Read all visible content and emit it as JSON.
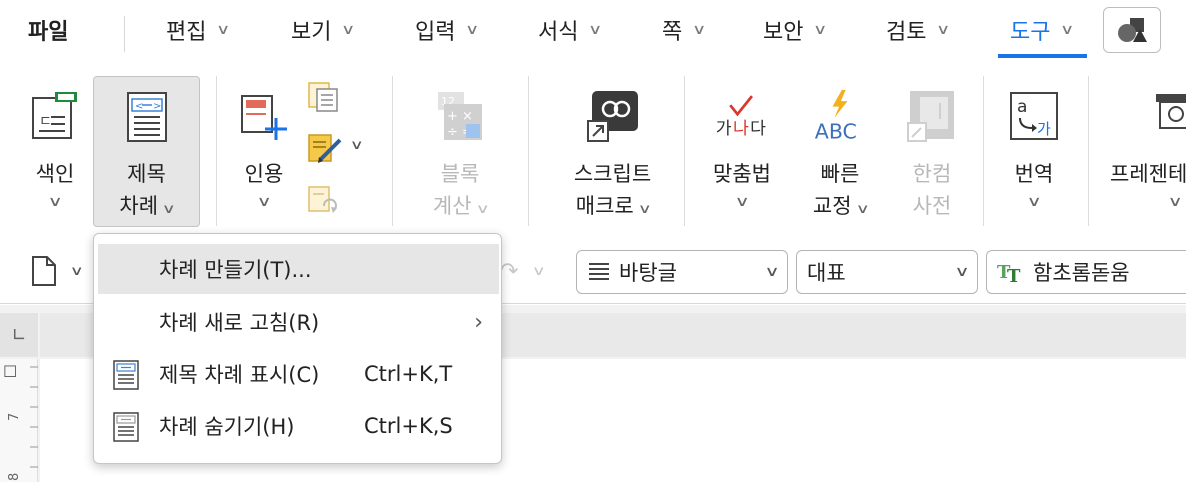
{
  "menubar": {
    "file": "파일",
    "items": [
      "편집",
      "보기",
      "입력",
      "서식",
      "쪽",
      "보안",
      "검토",
      "도구"
    ],
    "active": "도구",
    "accent": "#1a73e8"
  },
  "ribbon": {
    "index": {
      "label": "색인"
    },
    "toc": {
      "line1": "제목",
      "line2": "차례"
    },
    "citation": {
      "label": "인용"
    },
    "block_calc": {
      "line1": "블록",
      "line2": "계산"
    },
    "script": {
      "line1": "스크립트",
      "line2": "매크로"
    },
    "spell": {
      "label": "맞춤법",
      "icon_text_a": "가",
      "icon_text_b": "나",
      "icon_text_c": "다"
    },
    "quick_fix": {
      "line1": "빠른",
      "line2": "교정",
      "icon_text": "ABC"
    },
    "hancom_dict": {
      "line1": "한컴",
      "line2": "사전"
    },
    "translate": {
      "label": "번역",
      "icon_a": "a",
      "icon_b": "가"
    },
    "presentation": {
      "label": "프레젠테"
    }
  },
  "format_bar": {
    "style": "바탕글",
    "font_lang": "대표",
    "font": "함초롬돋움"
  },
  "dropdown": {
    "items": [
      {
        "label": "차례 만들기(T)...",
        "shortcut": "",
        "has_icon": false,
        "submenu": false
      },
      {
        "label": "차례 새로 고침(R)",
        "shortcut": "",
        "has_icon": false,
        "submenu": true
      },
      {
        "label": "제목 차례 표시(C)",
        "shortcut": "Ctrl+K,T",
        "has_icon": true,
        "submenu": false
      },
      {
        "label": "차례 숨기기(H)",
        "shortcut": "Ctrl+K,S",
        "has_icon": true,
        "submenu": false
      }
    ]
  },
  "rulers": {
    "v_marks": [
      "7",
      "8"
    ]
  }
}
